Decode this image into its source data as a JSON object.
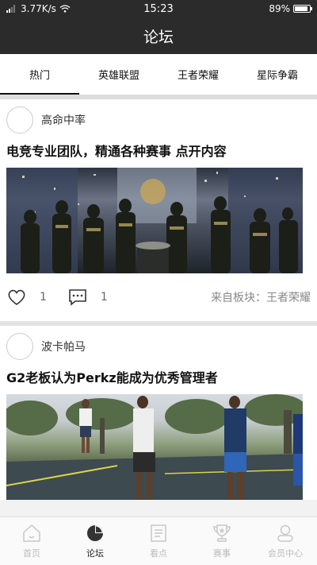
{
  "status": {
    "speed": "3.77K/s",
    "time": "15:23",
    "battery": "89%",
    "battery_level": 0.89
  },
  "header": {
    "title": "论坛"
  },
  "tabs": [
    {
      "label": "热门",
      "active": true
    },
    {
      "label": "英雄联盟",
      "active": false
    },
    {
      "label": "王者荣耀",
      "active": false
    },
    {
      "label": "星际争霸",
      "active": false
    }
  ],
  "posts": [
    {
      "author": "高命中率",
      "title": "电竞专业团队，精通各种赛事  点开内容",
      "likes": "1",
      "comments": "1",
      "source": "来自板块：王者荣耀",
      "image": "esports-team-on-stage-photo"
    },
    {
      "author": "波卡帕马",
      "title": "G2老板认为Perkz能成为优秀管理者",
      "image": "outdoor-basketball-court-photo"
    }
  ],
  "nav": [
    {
      "label": "首页",
      "icon": "home-icon",
      "active": false
    },
    {
      "label": "论坛",
      "icon": "pie-chart-icon",
      "active": true
    },
    {
      "label": "看点",
      "icon": "document-icon",
      "active": false
    },
    {
      "label": "赛事",
      "icon": "trophy-icon",
      "active": false
    },
    {
      "label": "会员中心",
      "icon": "user-icon",
      "active": false
    }
  ]
}
